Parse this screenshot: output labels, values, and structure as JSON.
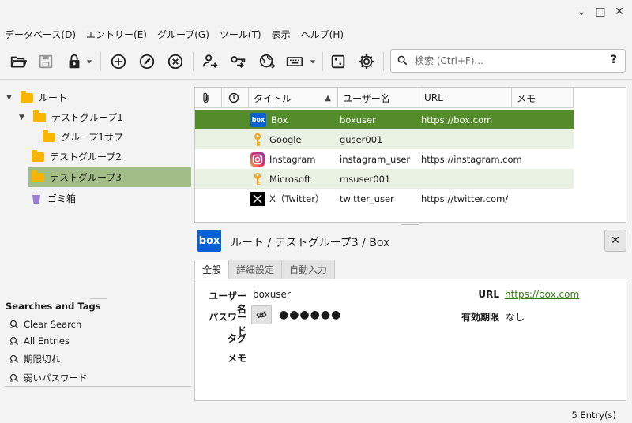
{
  "window": {
    "minimize": "⌄",
    "maximize": "□",
    "close": "✕"
  },
  "menu": [
    "データベース(D)",
    "エントリー(E)",
    "グループ(G)",
    "ツール(T)",
    "表示",
    "ヘルプ(H)"
  ],
  "toolbar": {
    "icons": [
      "open-folder-icon",
      "save-icon",
      "lock-icon",
      "add-entry-icon",
      "edit-entry-icon",
      "delete-entry-icon",
      "copy-username-icon",
      "copy-password-icon",
      "copy-url-icon",
      "autotype-icon",
      "password-generator-icon",
      "settings-icon"
    ]
  },
  "search": {
    "placeholder": "検索 (Ctrl+F)...",
    "value": "",
    "help": "?"
  },
  "tree": {
    "nodes": [
      {
        "label": "ルート",
        "expanded": true,
        "level": 0
      },
      {
        "label": "テストグループ1",
        "expanded": true,
        "level": 1
      },
      {
        "label": "グループ1サブ",
        "level": 2
      },
      {
        "label": "テストグループ2",
        "level": 1
      },
      {
        "label": "テストグループ3",
        "level": 1,
        "selected": true
      },
      {
        "label": "ゴミ箱",
        "level": 1,
        "recycle": true
      }
    ]
  },
  "searches_and_tags": {
    "title": "Searches and Tags",
    "items": [
      "Clear Search",
      "All Entries",
      "期限切れ",
      "弱いパスワード"
    ]
  },
  "table": {
    "columns": [
      "",
      "",
      "タイトル",
      "ユーザー名",
      "URL",
      "メモ"
    ],
    "sort_arrow": "▲",
    "rows": [
      {
        "title": "Box",
        "username": "boxuser",
        "url": "https://box.com",
        "icon": "box-logo-icon",
        "selected": true
      },
      {
        "title": "Google",
        "username": "guser001",
        "url": "",
        "icon": "key-icon"
      },
      {
        "title": "Instagram",
        "username": "instagram_user",
        "url": "https://instagram.com",
        "icon": "instagram-logo-icon"
      },
      {
        "title": "Microsoft",
        "username": "msuser001",
        "url": "",
        "icon": "key-icon"
      },
      {
        "title": "X（Twitter）",
        "username": "twitter_user",
        "url": "https://twitter.com/",
        "icon": "x-logo-icon"
      }
    ]
  },
  "details": {
    "icon_text": "box",
    "path": "ルート / テストグループ3 / Box",
    "close": "✕",
    "tabs": [
      "全般",
      "詳細設定",
      "自動入力"
    ],
    "fields": {
      "username_label": "ユーザー名",
      "username": "boxuser",
      "password_label": "パスワード",
      "password": "●●●●●●",
      "tags_label": "タグ",
      "notes_label": "メモ",
      "url_label": "URL",
      "url": "https://box.com",
      "expiry_label": "有効期限",
      "expiry": "なし"
    }
  },
  "status": {
    "entries": "5 Entry(s)"
  },
  "colors": {
    "selected_row": "#548b2b",
    "selected_group": "#a3bd88",
    "alt_row": "#e9f1e2",
    "folder": "#f7b500",
    "link": "#3b7a1a"
  }
}
